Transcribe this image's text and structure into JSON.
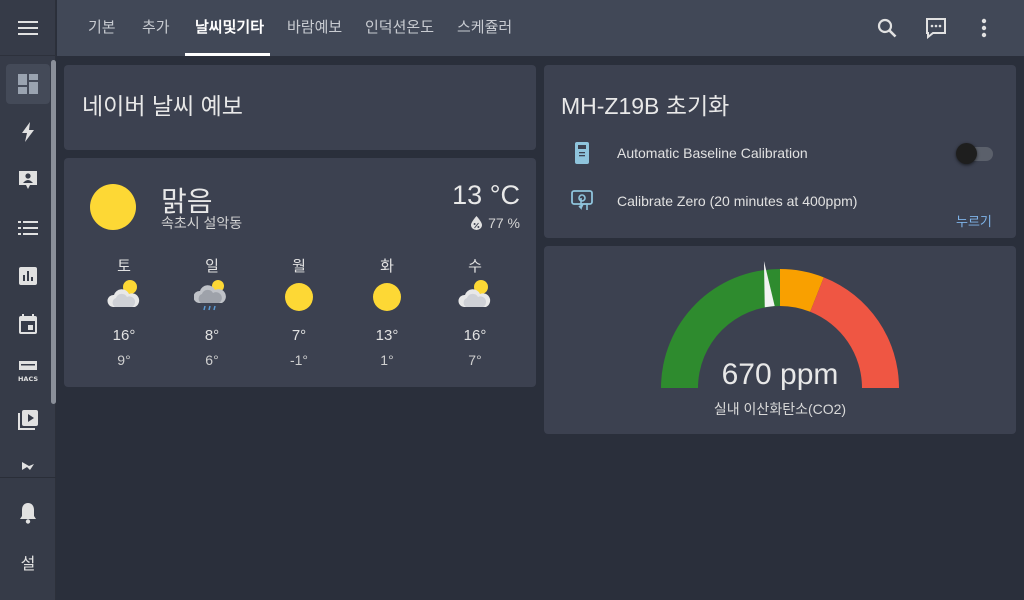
{
  "sidebar": {
    "items": [
      {
        "icon": "dashboard-icon",
        "active": true
      },
      {
        "icon": "lightning-icon"
      },
      {
        "icon": "account-box-icon"
      },
      {
        "icon": "list-icon"
      },
      {
        "icon": "chart-icon"
      },
      {
        "icon": "calendar-icon"
      },
      {
        "icon": "hacs-icon",
        "label": "HACS"
      },
      {
        "icon": "media-icon"
      },
      {
        "icon": "partial-icon"
      }
    ],
    "notifications_icon": "bell-icon",
    "settings_label": "설"
  },
  "header": {
    "tabs": [
      "기본",
      "추가",
      "날씨및기타",
      "바람예보",
      "인덕션온도",
      "스케쥴러"
    ],
    "active_tab": 2,
    "icons": [
      "search-icon",
      "chat-icon",
      "more-vert-icon"
    ]
  },
  "weather_title": "네이버 날씨 예보",
  "weather": {
    "condition": "맑음",
    "location": "속초시 설악동",
    "temperature": "13 °C",
    "humidity": "77 %",
    "forecast": [
      {
        "day": "토",
        "icon": "partly-cloudy-icon",
        "high": "16°",
        "low": "9°"
      },
      {
        "day": "일",
        "icon": "rainy-partly-cloudy-icon",
        "high": "8°",
        "low": "6°"
      },
      {
        "day": "월",
        "icon": "sun-icon",
        "high": "7°",
        "low": "-1°"
      },
      {
        "day": "화",
        "icon": "sun-icon",
        "high": "13°",
        "low": "1°"
      },
      {
        "day": "수",
        "icon": "partly-cloudy-icon",
        "high": "16°",
        "low": "7°"
      }
    ]
  },
  "mhz19": {
    "title": "MH-Z19B 초기화",
    "abc_label": "Automatic Baseline Calibration",
    "abc_on": false,
    "zero_label": "Calibrate Zero (20 minutes at 400ppm)",
    "press_label": "누르기"
  },
  "gauge": {
    "value_text": "670 ppm",
    "value": 670,
    "name": "실내 이산화탄소(CO2)",
    "colors": {
      "green": "#2e8b2e",
      "yellow": "#f9a000",
      "red": "#ef5643"
    }
  }
}
